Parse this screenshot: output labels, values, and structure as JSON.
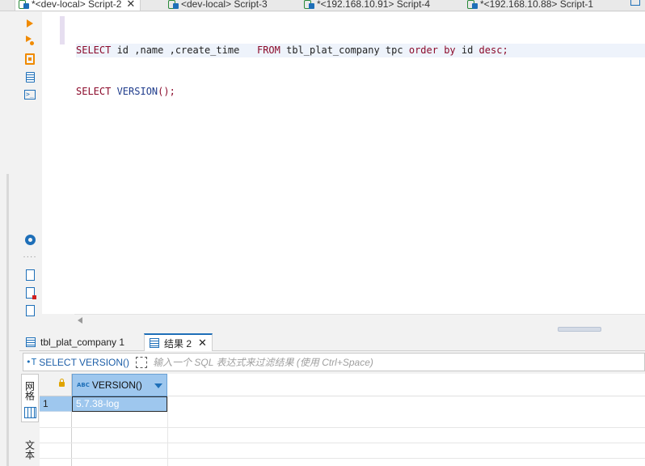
{
  "editor_tabs": [
    {
      "label": "*<dev-local> Script-2",
      "active": true
    },
    {
      "label": "<dev-local> Script-3",
      "active": false
    },
    {
      "label": "*<192.168.10.91> Script-4",
      "active": false
    },
    {
      "label": "*<192.168.10.88> Script-1",
      "active": false
    }
  ],
  "editor": {
    "line1": {
      "select": "SELECT",
      "cols": " id ,name ,create_time   ",
      "from": "FROM",
      "table": " tbl_plat_company tpc ",
      "order": "order by",
      "rest": " id ",
      "desc": "desc;"
    },
    "line2": {
      "select": "SELECT",
      "fn": " VERSION",
      "paren": "();"
    }
  },
  "result_tabs": [
    {
      "label": "tbl_plat_company 1",
      "active": false
    },
    {
      "label": "结果 2",
      "active": true
    }
  ],
  "filter": {
    "sql_label": "SELECT VERSION()",
    "placeholder": "输入一个 SQL 表达式来过滤结果 (使用 Ctrl+Space)"
  },
  "side_tabs": {
    "grid": "网格",
    "text": "文本"
  },
  "grid": {
    "column": "VERSION()",
    "column_type": "ABC",
    "rows": [
      {
        "num": "1",
        "value": "5.7.38-log"
      }
    ]
  },
  "colors": {
    "keyword": "#8b0a2a",
    "accent": "#1e6fb8",
    "selection": "#9ec7ee",
    "run_icon": "#f08a00"
  },
  "icons": [
    "execute-icon",
    "execute-script-icon",
    "explain-icon",
    "format-icon",
    "terminal-icon",
    "settings-icon",
    "export-icon",
    "import-icon",
    "file-icon",
    "table-icon",
    "lock-icon"
  ]
}
